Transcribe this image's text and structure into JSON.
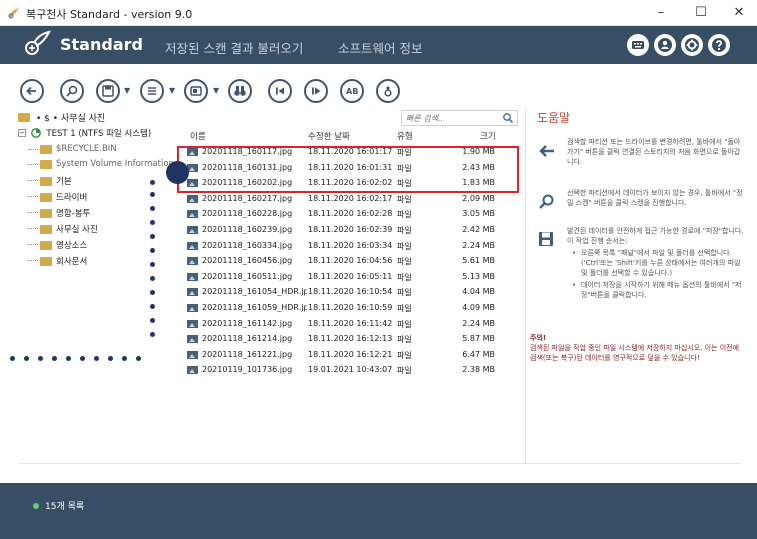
{
  "window": {
    "title": "복구천사 Standard - version 9.0",
    "controls": [
      "–",
      "☐",
      "✕"
    ]
  },
  "header": {
    "brand": "Standard",
    "nav": [
      "저장된 스캔 결과 불러오기",
      "소프트웨어 정보"
    ]
  },
  "toolbar": {
    "buttons": [
      "back",
      "search",
      "save",
      "list",
      "view",
      "binoculars",
      "prev",
      "next",
      "ab",
      "user"
    ]
  },
  "path": {
    "text": "• $ • 사무실 사진",
    "search_placeholder": "빠른 검색.."
  },
  "tree": {
    "root": "TEST 1 (NTFS 파일 시스템)",
    "items": [
      {
        "label": "$RECYCLE.BIN",
        "dim": true
      },
      {
        "label": "System Volume Information",
        "dim": true
      },
      {
        "label": "기본",
        "dim": false
      },
      {
        "label": "드라이버",
        "dim": false
      },
      {
        "label": "명함-봉투",
        "dim": false
      },
      {
        "label": "사무실 사진",
        "dim": false
      },
      {
        "label": "영상소스",
        "dim": false
      },
      {
        "label": "회사문서",
        "dim": false
      }
    ]
  },
  "files": {
    "columns": {
      "name": "이름",
      "date": "수정한 날짜",
      "type": "유형",
      "size": "크기"
    },
    "rows": [
      {
        "name": "20201118_160117.jpg",
        "date": "18.11.2020 16:01:17",
        "type": "파일",
        "size": "1.90 MB"
      },
      {
        "name": "20201118_160131.jpg",
        "date": "18.11.2020 16:01:31",
        "type": "파일",
        "size": "2.43 MB"
      },
      {
        "name": "20201118_160202.jpg",
        "date": "18.11.2020 16:02:02",
        "type": "파일",
        "size": "1.83 MB"
      },
      {
        "name": "20201118_160217.jpg",
        "date": "18.11.2020 16:02:17",
        "type": "파일",
        "size": "2.09 MB"
      },
      {
        "name": "20201118_160228.jpg",
        "date": "18.11.2020 16:02:28",
        "type": "파일",
        "size": "3.05 MB"
      },
      {
        "name": "20201118_160239.jpg",
        "date": "18.11.2020 16:02:39",
        "type": "파일",
        "size": "2.42 MB"
      },
      {
        "name": "20201118_160334.jpg",
        "date": "18.11.2020 16:03:34",
        "type": "파일",
        "size": "2.24 MB"
      },
      {
        "name": "20201118_160456.jpg",
        "date": "18.11.2020 16:04:56",
        "type": "파일",
        "size": "5.61 MB"
      },
      {
        "name": "20201118_160511.jpg",
        "date": "18.11.2020 16:05:11",
        "type": "파일",
        "size": "5.13 MB"
      },
      {
        "name": "20201118_161054_HDR.jp..",
        "date": "18.11.2020 16:10:54",
        "type": "파일",
        "size": "4.04 MB"
      },
      {
        "name": "20201118_161059_HDR.jp..",
        "date": "18.11.2020 16:10:59",
        "type": "파일",
        "size": "4.09 MB"
      },
      {
        "name": "20201118_161142.jpg",
        "date": "18.11.2020 16:11:42",
        "type": "파일",
        "size": "2.24 MB"
      },
      {
        "name": "20201118_161214.jpg",
        "date": "18.11.2020 16:12:13",
        "type": "파일",
        "size": "5.87 MB"
      },
      {
        "name": "20201118_161221.jpg",
        "date": "18.11.2020 16:12:21",
        "type": "파일",
        "size": "6.47 MB"
      },
      {
        "name": "20210119_101736.jpg",
        "date": "19.01.2021 10:43:07",
        "type": "파일",
        "size": "2.38 MB"
      }
    ]
  },
  "help": {
    "title": "도움말",
    "back_text": "검색할 파티션 또는 드라이브를 변경하려면, 툴바에서 \"돌아가기\" 버튼을 클릭 연결된 스토리지의 처음 화면으로 돌아갑니다.",
    "search_text": "선택한 파티션에서 데이터가 보이지 않는 경우, 툴바에서 \"정밀 스캔\" 버튼을 클릭 스캔을 진행합니다.",
    "save_text": "발견된 데이터를 안전하게 접근 가능한 경로에 \"저장\"합니다. 이 작업 진행 순서는:",
    "save_bullets": [
      "오른쪽 목록 \"패널\"에서 파일 및 폴더를 선택합니다. ('Ctrl'또는 'Shift'키를 누른 상태에서는 여러개의 파일 및 폴더를 선택할 수 있습니다.)",
      "데이터 저장을 시작하기 위해 메뉴 옵션의 툴바에서 \"저장\"버튼을 클릭합니다."
    ],
    "note_title": "주의!",
    "note_text": "검색된 파일을 작업 중인 파일 시스템에 저장하지 마십시오. 이는 이전에 검색(또는 복구)된 데이터를 영구적으로 덮을 수 있습니다!"
  },
  "status": {
    "text": "15개 목록"
  },
  "colors": {
    "header_bg": "#384e64",
    "highlight": "#e0222b",
    "help_title": "#c64a2e",
    "annotation": "#1f3462"
  }
}
